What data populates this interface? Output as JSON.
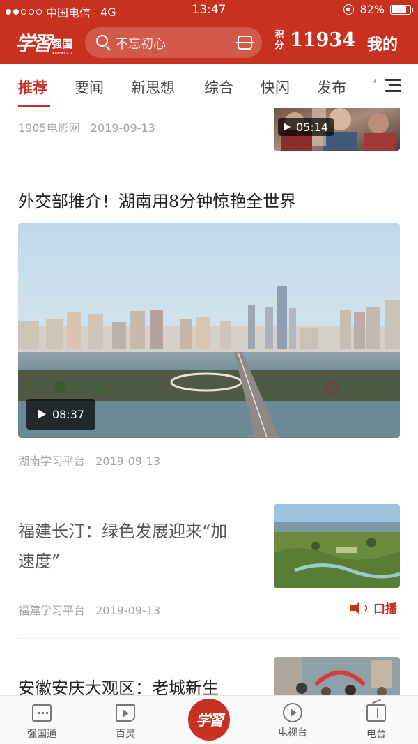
{
  "status_bar": {
    "carrier": "中国电信",
    "network": "4G",
    "time": "13:47",
    "battery_percent": "82%",
    "battery_level": 0.82,
    "signal_bars_filled": 2,
    "signal_bars_total": 5
  },
  "app_bar": {
    "logo_script": "学習",
    "logo_name": "强国",
    "logo_domain": "xuexi.cn",
    "search_placeholder": "不忘初心",
    "points_label_1": "积",
    "points_label_2": "分",
    "points_value": "11934",
    "mine_label": "我的"
  },
  "tabs": {
    "items": [
      {
        "label": "推荐",
        "active": true
      },
      {
        "label": "要闻",
        "active": false
      },
      {
        "label": "新思想",
        "active": false
      },
      {
        "label": "综合",
        "active": false
      },
      {
        "label": "快闪",
        "active": false
      },
      {
        "label": "发布",
        "active": false
      }
    ],
    "more_partial": "‘"
  },
  "feed": {
    "items": [
      {
        "source": "1905电影网",
        "date": "2019-09-13",
        "duration": "05:14"
      },
      {
        "title": "外交部推介！湖南用8分钟惊艳全世界",
        "source": "湖南学习平台",
        "date": "2019-09-13",
        "duration": "08:37"
      },
      {
        "title_line1": "福建长汀：绿色发展迎来“加",
        "title_line2": "速度”",
        "source": "福建学习平台",
        "date": "2019-09-13",
        "audio_label": "口播"
      },
      {
        "title": "安徽安庆大观区：老城新生"
      }
    ]
  },
  "bottom_nav": {
    "items": [
      {
        "label": "强国通",
        "icon": "chat-icon"
      },
      {
        "label": "百灵",
        "icon": "baike-play-icon"
      },
      {
        "label": "",
        "icon": "xuexi-center-logo",
        "center_text": "学習"
      },
      {
        "label": "电视台",
        "icon": "tv-play-icon"
      },
      {
        "label": "电台",
        "icon": "radio-icon"
      }
    ]
  },
  "colors": {
    "brand_red": "#c8301f",
    "text_dark": "#222222",
    "text_meta": "#a3a3a3"
  }
}
